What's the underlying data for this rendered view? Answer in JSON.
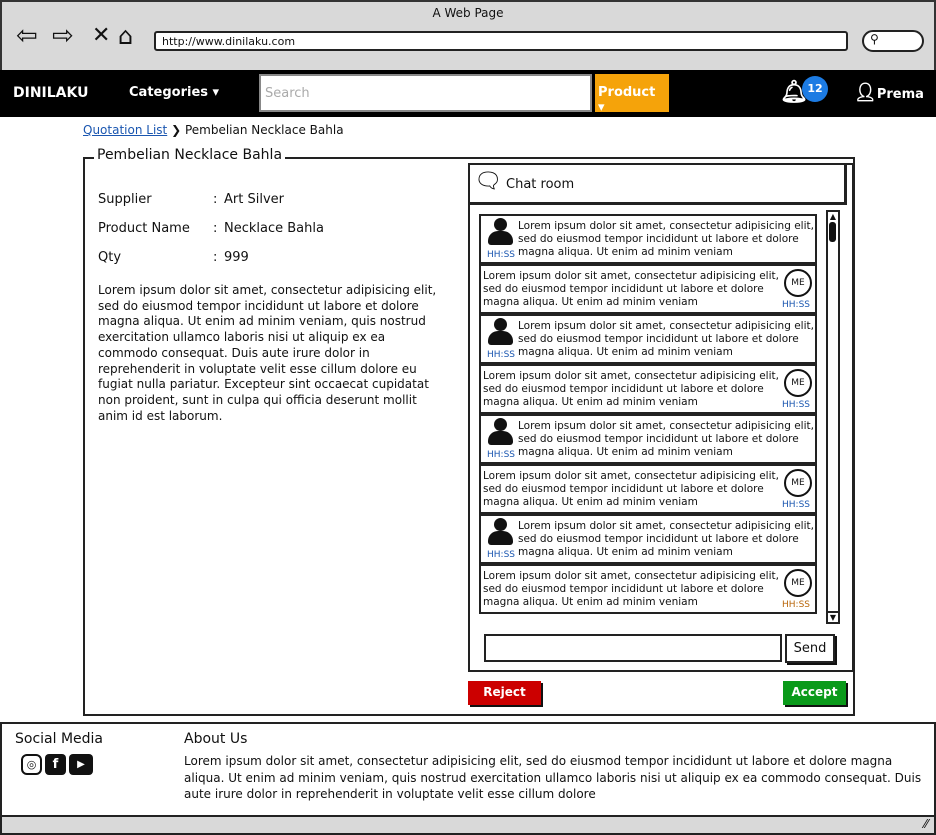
{
  "window": {
    "title": "A Web Page",
    "url": "http://www.dinilaku.com"
  },
  "nav": {
    "brand": "DINILAKU",
    "categories": "Categories ▾",
    "search_placeholder": "Search",
    "product": "Product ▾",
    "notifications": "12",
    "user": "Prema"
  },
  "breadcrumb": {
    "parent": "Quotation List",
    "separator": "❯",
    "current": "Pembelian Necklace Bahla"
  },
  "panel": {
    "title": "Pembelian Necklace Bahla",
    "fields": [
      {
        "label": "Supplier",
        "value": "Art Silver"
      },
      {
        "label": "Product Name",
        "value": "Necklace Bahla"
      },
      {
        "label": "Qty",
        "value": "999"
      }
    ],
    "colon": ":",
    "description": "Lorem ipsum dolor sit amet, consectetur adipisicing elit, sed do eiusmod tempor incididunt ut labore et dolore magna aliqua. Ut enim ad minim veniam, quis nostrud exercitation ullamco laboris nisi ut aliquip ex ea commodo consequat. Duis aute irure dolor in reprehenderit in voluptate velit esse cillum dolore eu fugiat nulla pariatur. Excepteur sint occaecat cupidatat non proident, sunt in culpa qui officia deserunt mollit anim id est laborum."
  },
  "chat": {
    "title": "Chat room",
    "me_label": "ME",
    "send": "Send",
    "messages": [
      {
        "from": "other",
        "lines": [
          "Lorem ipsum dolor sit amet, consectetur adipisicing elit,",
          "sed do eiusmod tempor incididunt ut labore et dolore",
          "magna aliqua. Ut enim ad minim veniam"
        ],
        "time": "HH:SS"
      },
      {
        "from": "me",
        "lines": [
          "Lorem ipsum dolor sit amet, consectetur adipisicing elit,",
          "sed do eiusmod tempor incididunt ut labore et dolore",
          "magna aliqua. Ut enim ad minim veniam"
        ],
        "time": "HH:SS"
      },
      {
        "from": "other",
        "lines": [
          "Lorem ipsum dolor sit amet, consectetur adipisicing elit,",
          "sed do eiusmod tempor incididunt ut labore et dolore",
          "magna aliqua. Ut enim ad minim veniam"
        ],
        "time": "HH:SS"
      },
      {
        "from": "me",
        "lines": [
          "Lorem ipsum dolor sit amet, consectetur adipisicing elit,",
          "sed do eiusmod tempor incididunt ut labore et dolore",
          "magna aliqua. Ut enim ad minim veniam"
        ],
        "time": "HH:SS"
      },
      {
        "from": "other",
        "lines": [
          "Lorem ipsum dolor sit amet, consectetur adipisicing elit,",
          "sed do eiusmod tempor incididunt ut labore et dolore",
          "magna aliqua. Ut enim ad minim veniam"
        ],
        "time": "HH:SS"
      },
      {
        "from": "me",
        "lines": [
          "Lorem ipsum dolor sit amet, consectetur adipisicing elit,",
          "sed do eiusmod tempor incididunt ut labore et dolore",
          "magna aliqua. Ut enim ad minim veniam"
        ],
        "time": "HH:SS"
      },
      {
        "from": "other",
        "lines": [
          "Lorem ipsum dolor sit amet, consectetur adipisicing elit,",
          "sed do eiusmod tempor incididunt ut labore et dolore",
          "magna aliqua. Ut enim ad minim veniam"
        ],
        "time": "HH:SS"
      },
      {
        "from": "me",
        "lines": [
          "Lorem ipsum dolor sit amet, consectetur adipisicing elit,",
          "sed do eiusmod tempor incididunt ut labore et dolore",
          "magna aliqua. Ut enim ad minim veniam"
        ],
        "time": "HH:SS",
        "time_color": "#b8660a"
      }
    ]
  },
  "actions": {
    "reject": "Reject",
    "accept": "Accept"
  },
  "footer": {
    "social_title": "Social Media",
    "about_title": "About Us",
    "about_text": "Lorem ipsum dolor sit amet, consectetur adipisicing elit, sed do eiusmod tempor incididunt ut labore et dolore magna aliqua. Ut enim ad minim veniam, quis nostrud exercitation ullamco laboris nisi ut aliquip ex ea commodo consequat. Duis aute irure dolor in reprehenderit in voluptate velit esse cillum dolore"
  },
  "colors": {
    "accent": "#f5a30a",
    "badge": "#1c7be3",
    "reject": "#cc0000",
    "accept": "#0a9a1a",
    "link": "#1a56b0"
  }
}
